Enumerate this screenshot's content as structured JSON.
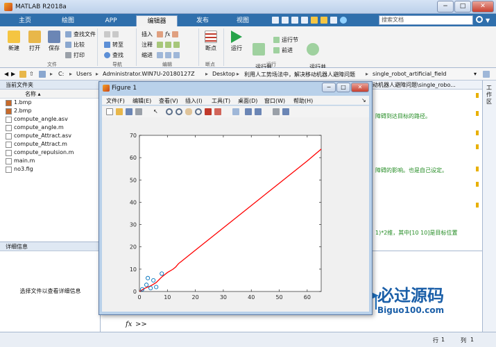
{
  "app": {
    "title": "MATLAB R2018a",
    "window_controls": [
      "−",
      "□",
      "✕"
    ]
  },
  "tabs": [
    "主页",
    "绘图",
    "APP",
    "编辑器",
    "发布",
    "视图"
  ],
  "active_tab": "编辑器",
  "search": {
    "placeholder": "搜索文档"
  },
  "ribbon": {
    "file": {
      "new": "新建",
      "open": "打开",
      "save": "保存",
      "find_files": "查找文件",
      "compare": "比较",
      "print": "打印",
      "group": "文件"
    },
    "nav": {
      "goto": "转至",
      "find": "查找",
      "group": "导航"
    },
    "edit": {
      "insert": "插入",
      "comment": "注释",
      "indent": "缩进",
      "fx": "fx",
      "group": "编辑"
    },
    "breakpoints": {
      "label": "断点",
      "group": "断点"
    },
    "run": {
      "run": "运行",
      "run_advance": "运行并\n前进",
      "run_section": "运行节",
      "advance": "前进",
      "run_time": "运行并\n计时",
      "group": "运行"
    },
    "accent": "#2f6fac"
  },
  "address": {
    "parts": [
      "C:",
      "Users",
      "Administrator.WIN7U-20180127Z",
      "Desktop",
      "利用人工势场法中，解决移动机器人避障问题",
      "single_robot_artificial_field"
    ]
  },
  "current_folder": {
    "title": "当前文件夹",
    "column": "名称 ▴",
    "files": [
      {
        "name": "1.bmp",
        "icon": "image-icon"
      },
      {
        "name": "2.bmp",
        "icon": "image-icon"
      },
      {
        "name": "compute_angle.asv",
        "icon": "file-icon"
      },
      {
        "name": "compute_angle.m",
        "icon": "m-file-icon"
      },
      {
        "name": "compute_Attract.asv",
        "icon": "file-icon"
      },
      {
        "name": "compute_Attract.m",
        "icon": "m-file-icon"
      },
      {
        "name": "compute_repulsion.m",
        "icon": "m-file-icon"
      },
      {
        "name": "main.m",
        "icon": "m-file-icon"
      },
      {
        "name": "no3.fig",
        "icon": "fig-file-icon"
      }
    ]
  },
  "details": {
    "title": "详细信息",
    "message": "选择文件以查看详细信息"
  },
  "editor": {
    "tab_text": "动机器人避障问题\\single_robo...",
    "comments": [
      "障碍到达目标的路径。",
      "障碍的影响。也是自己设定。",
      "1)*2维，其中[10 10]是目标位置"
    ]
  },
  "side_panel": {
    "label": "工作区"
  },
  "command_window": {
    "prompt": ">>",
    "fx": "fx"
  },
  "status": {
    "row_label": "行",
    "row": "1",
    "col_label": "列",
    "col": "1"
  },
  "watermark": {
    "brand": "必过源码",
    "url": "Biguo100.com"
  },
  "figure": {
    "title": "Figure 1",
    "menu": [
      "文件(F)",
      "编辑(E)",
      "查看(V)",
      "插入(I)",
      "工具(T)",
      "桌面(D)",
      "窗口(W)",
      "帮助(H)"
    ]
  },
  "chart_data": {
    "type": "line",
    "xlim": [
      0,
      65
    ],
    "ylim": [
      0,
      70
    ],
    "xticks": [
      0,
      10,
      20,
      30,
      40,
      50,
      60
    ],
    "yticks": [
      0,
      10,
      20,
      30,
      40,
      50,
      60,
      70
    ],
    "title": "",
    "xlabel": "",
    "ylabel": "",
    "series": [
      {
        "kind": "line",
        "color": "#ff0000",
        "points": [
          [
            0,
            0
          ],
          [
            2,
            1.5
          ],
          [
            4,
            2.5
          ],
          [
            6,
            4
          ],
          [
            8,
            6.5
          ],
          [
            10,
            8.5
          ],
          [
            12,
            10
          ],
          [
            13,
            11
          ],
          [
            14,
            12.5
          ],
          [
            15,
            13.5
          ],
          [
            20,
            18.5
          ],
          [
            30,
            28.5
          ],
          [
            40,
            38.5
          ],
          [
            50,
            48.5
          ],
          [
            60,
            58.5
          ],
          [
            68,
            67
          ]
        ]
      },
      {
        "kind": "markers",
        "marker": "circle",
        "color": "#0072bd",
        "points": [
          [
            1,
            1
          ],
          [
            2.5,
            3
          ],
          [
            3,
            6
          ],
          [
            5,
            5
          ],
          [
            6,
            2
          ],
          [
            8,
            8
          ],
          [
            4,
            1.5
          ]
        ]
      }
    ]
  }
}
